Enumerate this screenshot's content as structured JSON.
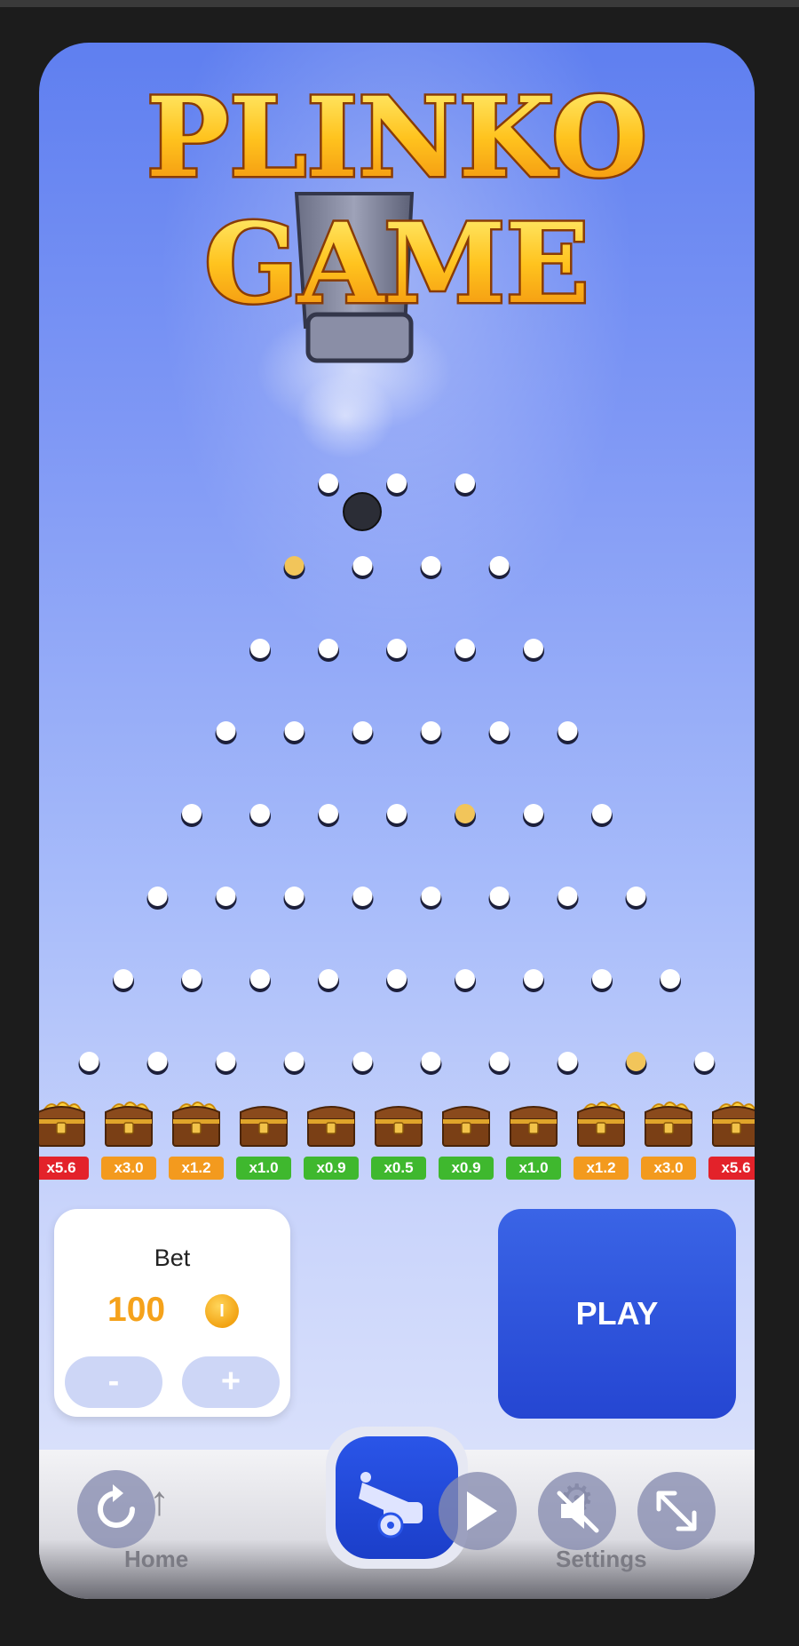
{
  "title": {
    "line1": "PLINKO",
    "line2": "GAME"
  },
  "board": {
    "rows": [
      3,
      4,
      5,
      6,
      7,
      8,
      9,
      10
    ],
    "gold_pegs": [
      [
        1,
        0
      ],
      [
        4,
        4
      ],
      [
        7,
        8
      ]
    ],
    "ball_visible": true
  },
  "slots": [
    {
      "label": "x5.6",
      "color": "#e3222a",
      "chest": "gold"
    },
    {
      "label": "x3.0",
      "color": "#f39a1e",
      "chest": "gold"
    },
    {
      "label": "x1.2",
      "color": "#f39a1e",
      "chest": "gold"
    },
    {
      "label": "x1.0",
      "color": "#3fb82e",
      "chest": "empty"
    },
    {
      "label": "x0.9",
      "color": "#3fb82e",
      "chest": "empty"
    },
    {
      "label": "x0.5",
      "color": "#3fb82e",
      "chest": "empty"
    },
    {
      "label": "x0.9",
      "color": "#3fb82e",
      "chest": "empty"
    },
    {
      "label": "x1.0",
      "color": "#3fb82e",
      "chest": "empty"
    },
    {
      "label": "x1.2",
      "color": "#f39a1e",
      "chest": "gold"
    },
    {
      "label": "x3.0",
      "color": "#f39a1e",
      "chest": "gold"
    },
    {
      "label": "x5.6",
      "color": "#e3222a",
      "chest": "gold"
    }
  ],
  "bet": {
    "label": "Bet",
    "value": "100",
    "coin_symbol": "I",
    "minus_label": "-",
    "plus_label": "+"
  },
  "play_label": "PLAY",
  "nav": {
    "home_label": "Home",
    "settings_label": "Settings"
  },
  "colors": {
    "accent": "#2a55e8",
    "peg": "#ffffff",
    "peg_gold": "#f2c55a",
    "coin": "#f5a21b"
  }
}
